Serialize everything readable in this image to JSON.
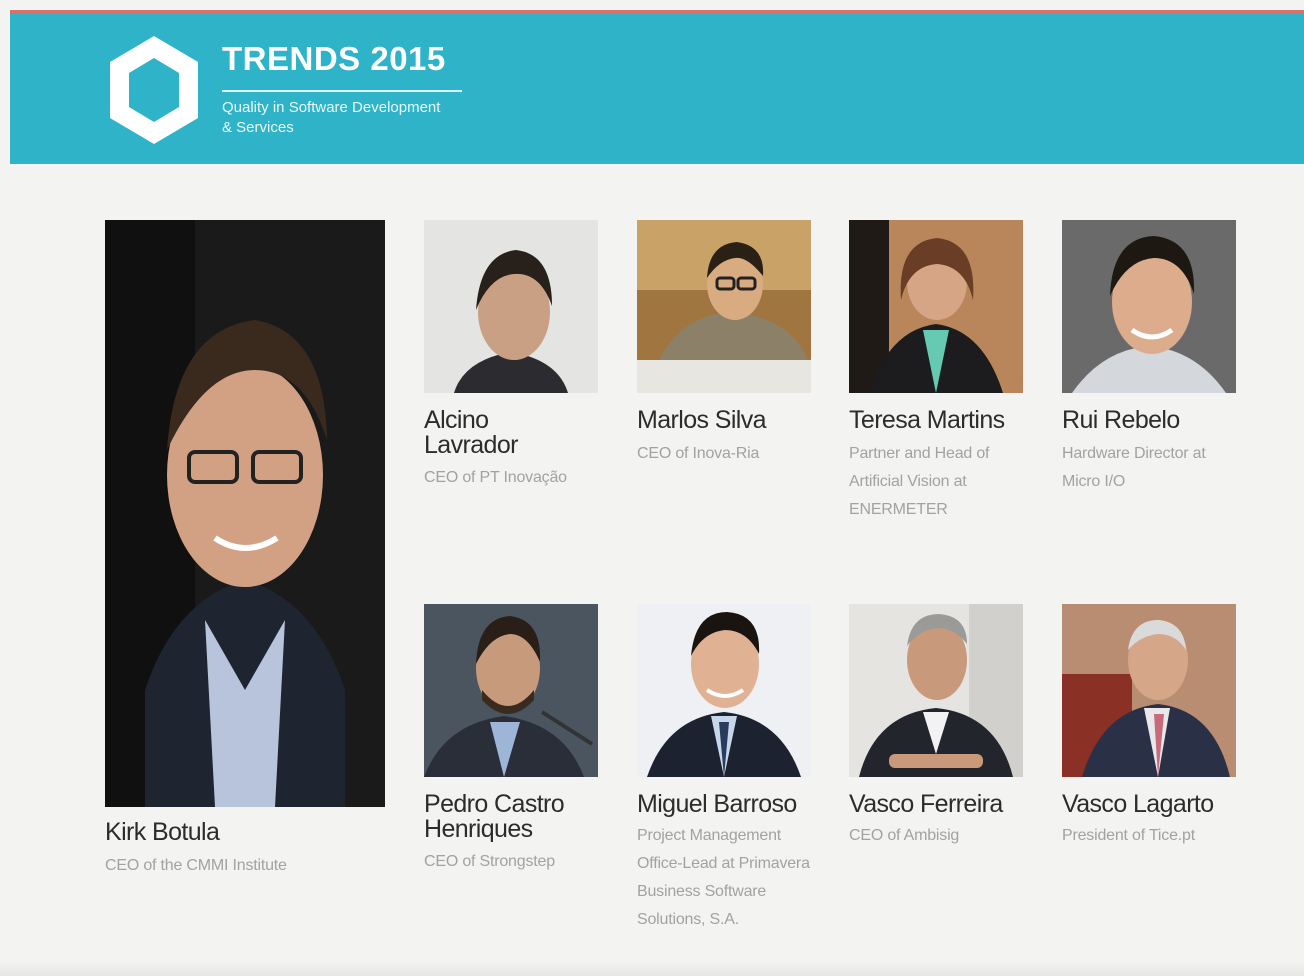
{
  "header": {
    "title": "TRENDS 2015",
    "subtitle_line1": "Quality in Software Development",
    "subtitle_line2": "& Services",
    "logo_icon": "hexagon-icon",
    "color": "#2fb3c9"
  },
  "speakers": [
    {
      "name": "Kirk Botula",
      "role": "CEO of the CMMI Institute",
      "photo": "portrait"
    },
    {
      "name": "Alcino Lavrador",
      "role": "CEO of PT Inovação",
      "photo": "portrait"
    },
    {
      "name": "Marlos Silva",
      "role": "CEO of Inova-Ria",
      "photo": "portrait"
    },
    {
      "name": "Teresa Martins",
      "role": "Partner and Head of Artificial Vision at ENERMETER",
      "photo": "portrait"
    },
    {
      "name": "Rui Rebelo",
      "role": "Hardware Director at Micro I/O",
      "photo": "portrait"
    },
    {
      "name": "Pedro Castro Henriques",
      "role": "CEO of Strongstep",
      "photo": "portrait"
    },
    {
      "name": "Miguel Barroso",
      "role": "Project Management Office-Lead at Primavera Business Software Solutions, S.A.",
      "photo": "portrait"
    },
    {
      "name": "Vasco Ferreira",
      "role": "CEO of Ambisig",
      "photo": "portrait"
    },
    {
      "name": "Vasco Lagarto",
      "role": "President of Tice.pt",
      "photo": "portrait"
    }
  ]
}
